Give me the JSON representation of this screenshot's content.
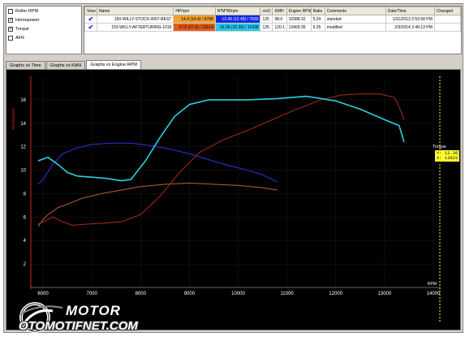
{
  "channels": [
    {
      "label": "Roller RPM",
      "checked": false
    },
    {
      "label": "Horsepower",
      "checked": true
    },
    {
      "label": "Torque",
      "checked": true
    },
    {
      "label": "AFR",
      "checked": false
    }
  ],
  "table": {
    "headers": [
      "View",
      "Name",
      "HP/rpm",
      "N*M*M/rpm",
      "cm3",
      "KMH",
      "Engine RPM",
      "Ratio",
      "Comments",
      "Date/Time",
      "Changed"
    ],
    "rows": [
      {
        "view": "✔",
        "name": "150-WILLY-STOCK-0007-BEST",
        "hp": "14.4 (14.4) / 8788",
        "nm": "12.49 (12.49) / 7630",
        "cm3": "125",
        "kmh": "98.0",
        "rpm": "10388.32",
        "ratio": "5.24",
        "comments": "standart",
        "date": "1/31/2013 2:53:58 PM",
        "changed": ""
      },
      {
        "view": "✔",
        "name": "150-WILLY-AFTERTURING-1019",
        "hp": "27.8 (27.8) / 12614",
        "nm": "16.36 (16.36) / 11438",
        "cm3": "125",
        "kmh": "120.1",
        "rpm": "13469.35",
        "ratio": "5.25",
        "comments": "modified",
        "date": "2/3/2014 2:49:13 PM",
        "changed": ""
      }
    ]
  },
  "tabs": [
    "Graphs vs Time",
    "Graphs vs KMH",
    "Graphs vs Engine RPM"
  ],
  "active_tab": "Graphs vs Engine RPM",
  "colors": {
    "stock_hp": "#f3a02d",
    "stock_torque": "#1226e6",
    "mod_hp": "#e65a1a",
    "mod_torque": "#28c8e6",
    "hp_line_stock": "#a85a2a",
    "hp_line_mod": "#9a2a18",
    "tq_line_stock": "#2a30c8",
    "tq_line_mod": "#28d0e0",
    "axis_hp": "#cc2222"
  },
  "chart_data": {
    "type": "line",
    "xlabel": "RPM",
    "ylabel": "Horsepower",
    "xlim": [
      5750,
      14000
    ],
    "ylim": [
      0,
      18
    ],
    "x_ticks": [
      6000,
      7000,
      8000,
      9000,
      10000,
      11000,
      12000,
      13000,
      14000
    ],
    "y_ticks": [
      2,
      4,
      6,
      8,
      10,
      12,
      14,
      16
    ],
    "series": [
      {
        "name": "",
        "kind": "hp_stock",
        "x": [
          5900,
          6000,
          6100,
          6300,
          6500,
          6800,
          7200,
          7600,
          8000,
          8500,
          9000,
          9500,
          10000,
          10500,
          10800
        ],
        "y": [
          5.2,
          5.8,
          6.2,
          6.8,
          7.1,
          7.6,
          8.0,
          8.3,
          8.6,
          8.8,
          8.9,
          8.8,
          8.7,
          8.5,
          8.3
        ]
      },
      {
        "name": "",
        "kind": "tq_stock",
        "x": [
          5900,
          6000,
          6200,
          6400,
          6700,
          7000,
          7400,
          7800,
          8200,
          8600,
          9000,
          9400,
          9800,
          10200,
          10500,
          10800
        ],
        "y": [
          8.8,
          9.2,
          10.5,
          11.4,
          11.9,
          12.2,
          12.3,
          12.3,
          12.1,
          11.8,
          11.4,
          10.9,
          10.4,
          10.0,
          9.6,
          9.0
        ]
      },
      {
        "name": "",
        "kind": "hp_mod",
        "x": [
          5900,
          6200,
          6400,
          6600,
          6900,
          7300,
          7600,
          8000,
          8400,
          8800,
          9200,
          9700,
          10200,
          10700,
          11200,
          11700,
          12100,
          12500,
          12900,
          13200,
          13300,
          13400
        ],
        "y": [
          5.4,
          6.0,
          5.6,
          5.3,
          5.4,
          5.5,
          5.6,
          6.2,
          7.8,
          9.8,
          11.5,
          12.6,
          13.4,
          14.3,
          15.2,
          16.0,
          16.4,
          16.5,
          16.5,
          16.2,
          15.4,
          14.3
        ]
      },
      {
        "name": "",
        "kind": "tq_mod",
        "x": [
          5900,
          6100,
          6300,
          6500,
          6700,
          7000,
          7300,
          7600,
          7800,
          8100,
          8400,
          8700,
          9000,
          9400,
          9800,
          10200,
          10800,
          11400,
          12000,
          12500,
          13000,
          13300,
          13400
        ],
        "y": [
          10.8,
          11.1,
          10.5,
          9.8,
          9.5,
          9.4,
          9.3,
          9.1,
          9.2,
          10.8,
          12.8,
          14.6,
          15.6,
          16.0,
          16.0,
          16.0,
          16.1,
          16.3,
          15.9,
          15.2,
          14.3,
          13.8,
          12.4
        ]
      }
    ]
  },
  "cursor": {
    "label": "Torque",
    "value_y": "Y: 12.36",
    "value_x": "X: 13622"
  },
  "logo": {
    "top": "MOTOR",
    "bottom": "OTOMOTIFNET.COM"
  }
}
